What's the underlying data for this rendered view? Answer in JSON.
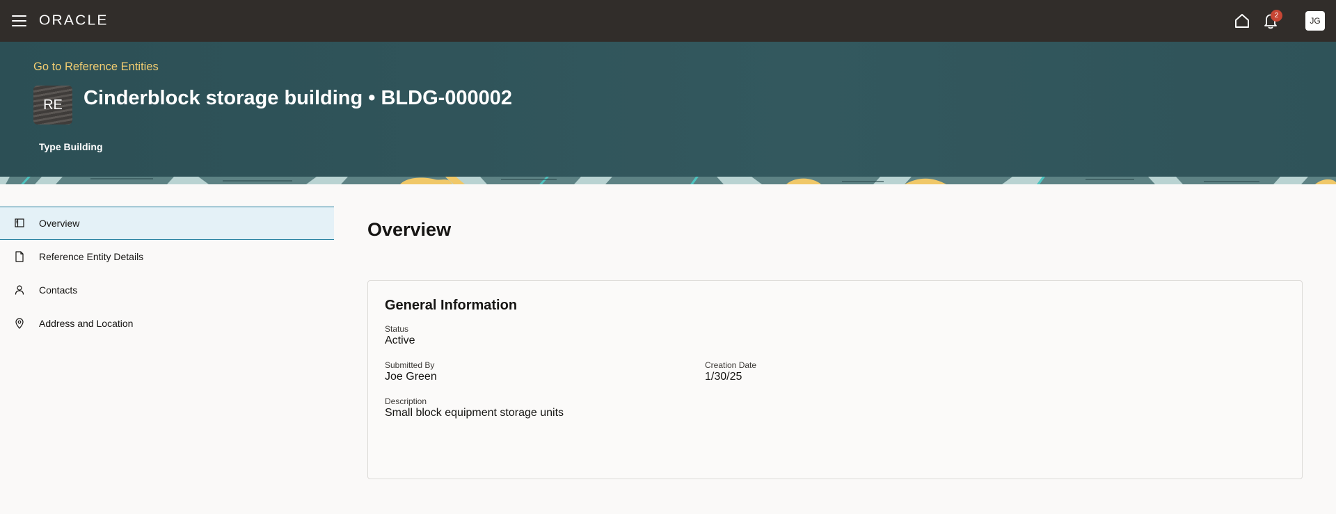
{
  "topbar": {
    "logo": "ORACLE",
    "notification_count": "2",
    "user_initials": "JG"
  },
  "header": {
    "back_link": "Go to Reference Entities",
    "avatar_initials": "RE",
    "title": "Cinderblock storage building • BLDG-000002",
    "type_label": "Type Building"
  },
  "sidebar": {
    "items": [
      {
        "label": "Overview",
        "icon": "panel-icon",
        "active": true
      },
      {
        "label": "Reference Entity Details",
        "icon": "document-icon",
        "active": false
      },
      {
        "label": "Contacts",
        "icon": "person-icon",
        "active": false
      },
      {
        "label": "Address and Location",
        "icon": "location-pin-icon",
        "active": false
      }
    ]
  },
  "main": {
    "title": "Overview",
    "card": {
      "title": "General Information",
      "status_label": "Status",
      "status_value": "Active",
      "submitted_by_label": "Submitted By",
      "submitted_by_value": "Joe Green",
      "creation_date_label": "Creation Date",
      "creation_date_value": "1/30/25",
      "description_label": "Description",
      "description_value": "Small block equipment storage units"
    }
  },
  "colors": {
    "topbar_bg": "#312d2a",
    "header_bg": "#2f5258",
    "link_accent": "#f0cc71",
    "active_nav_bg": "#e4f1f7",
    "active_nav_border": "#227e9e",
    "badge_bg": "#c74634"
  }
}
